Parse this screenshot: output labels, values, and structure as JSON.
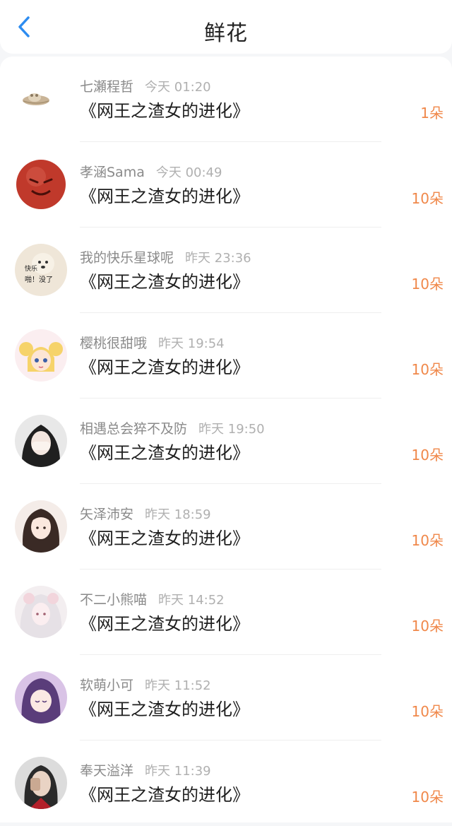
{
  "header": {
    "title": "鲜花",
    "back_icon": "chevron-left-icon"
  },
  "colors": {
    "accent": "#2d8cf0",
    "count": "#f0884a"
  },
  "items": [
    {
      "name": "七瀬程哲",
      "time": "今天 01:20",
      "book": "《网王之渣女的进化》",
      "count": "1朵"
    },
    {
      "name": "孝涵Sama",
      "time": "今天 00:49",
      "book": "《网王之渣女的进化》",
      "count": "10朵"
    },
    {
      "name": "我的快乐星球呢",
      "time": "昨天 23:36",
      "book": "《网王之渣女的进化》",
      "count": "10朵",
      "avatar_text": [
        "快乐",
        "啪！没了"
      ]
    },
    {
      "name": "樱桃很甜哦",
      "time": "昨天 19:54",
      "book": "《网王之渣女的进化》",
      "count": "10朵"
    },
    {
      "name": "相遇总会猝不及防",
      "time": "昨天 19:50",
      "book": "《网王之渣女的进化》",
      "count": "10朵"
    },
    {
      "name": "矢泽沛安",
      "time": "昨天 18:59",
      "book": "《网王之渣女的进化》",
      "count": "10朵"
    },
    {
      "name": "不二小熊喵",
      "time": "昨天 14:52",
      "book": "《网王之渣女的进化》",
      "count": "10朵"
    },
    {
      "name": "软萌小可",
      "time": "昨天 11:52",
      "book": "《网王之渣女的进化》",
      "count": "10朵"
    },
    {
      "name": "奉天溢洋",
      "time": "昨天 11:39",
      "book": "《网王之渣女的进化》",
      "count": "10朵"
    }
  ]
}
